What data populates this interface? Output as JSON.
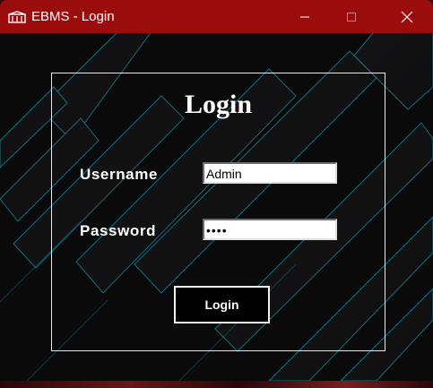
{
  "window": {
    "title": "EBMS - Login",
    "icon": "app-logo-icon",
    "controls": {
      "minimize": "minimize-icon",
      "maximize": "maximize-icon",
      "close": "close-icon"
    },
    "titlebar_color": "#9b0d0d"
  },
  "form": {
    "heading": "Login",
    "username_label": "Username",
    "username_value": "Admin",
    "password_label": "Password",
    "password_value": "••••",
    "login_button": "Login"
  },
  "colors": {
    "background": "#0a0a0b",
    "accent_lines": "#1e8aa0",
    "panel_border": "#e8e8e8"
  }
}
